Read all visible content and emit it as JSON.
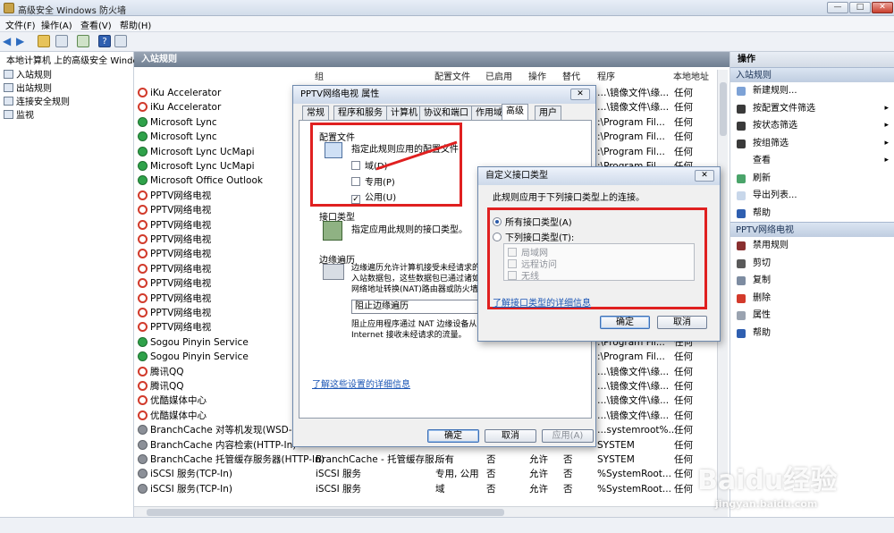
{
  "window": {
    "title": "高级安全 Windows 防火墙",
    "min": "—",
    "max": "□",
    "close": "✕"
  },
  "menu": [
    "文件(F)",
    "操作(A)",
    "查看(V)",
    "帮助(H)"
  ],
  "tree": {
    "root": "本地计算机 上的高级安全 Windo",
    "items": [
      "入站规则",
      "出站规则",
      "连接安全规则",
      "监视"
    ]
  },
  "center": {
    "title": "入站规则",
    "columns": [
      "组",
      "配置文件",
      "已启用",
      "操作",
      "替代",
      "程序",
      "本地地址"
    ],
    "rows": [
      {
        "name": "iKu Accelerator",
        "status": "block",
        "program": "…\\镜像文件\\缘...",
        "local": "任何"
      },
      {
        "name": "iKu Accelerator",
        "status": "block",
        "program": "…\\镜像文件\\缘...",
        "local": "任何"
      },
      {
        "name": "Microsoft Lync",
        "status": "ok",
        "program": ":\\Program Fil...",
        "local": "任何"
      },
      {
        "name": "Microsoft Lync",
        "status": "ok",
        "program": ":\\Program Fil...",
        "local": "任何"
      },
      {
        "name": "Microsoft Lync UcMapi",
        "status": "ok",
        "program": ":\\Program Fil...",
        "local": "任何"
      },
      {
        "name": "Microsoft Lync UcMapi",
        "status": "ok",
        "program": ":\\Program Fil...",
        "local": "任何"
      },
      {
        "name": "Microsoft Office Outlook",
        "status": "ok",
        "program": ":\\Program Fil...",
        "local": "任何"
      },
      {
        "name": "PPTV网络电视",
        "status": "block",
        "program": "",
        "local": ""
      },
      {
        "name": "PPTV网络电视",
        "status": "block",
        "program": "",
        "local": ""
      },
      {
        "name": "PPTV网络电视",
        "status": "block",
        "program": "",
        "local": ""
      },
      {
        "name": "PPTV网络电视",
        "status": "block",
        "program": "",
        "local": ""
      },
      {
        "name": "PPTV网络电视",
        "status": "block",
        "program": "",
        "local": ""
      },
      {
        "name": "PPTV网络电视",
        "status": "block",
        "program": "",
        "local": ""
      },
      {
        "name": "PPTV网络电视",
        "status": "block",
        "program": "",
        "local": ""
      },
      {
        "name": "PPTV网络电视",
        "status": "block",
        "program": "",
        "local": ""
      },
      {
        "name": "PPTV网络电视",
        "status": "block",
        "program": "",
        "local": ""
      },
      {
        "name": "PPTV网络电视",
        "status": "block",
        "program": "",
        "local": ""
      },
      {
        "name": "Sogou Pinyin Service",
        "status": "ok",
        "program": ":\\Program Fil...",
        "local": "任何"
      },
      {
        "name": "Sogou Pinyin Service",
        "status": "ok",
        "program": ":\\Program Fil...",
        "local": "任何"
      },
      {
        "name": "腾讯QQ",
        "status": "block",
        "program": "…\\镜像文件\\缘...",
        "local": "任何"
      },
      {
        "name": "腾讯QQ",
        "status": "block",
        "program": "…\\镜像文件\\缘...",
        "local": "任何"
      },
      {
        "name": "优酷媒体中心",
        "status": "block",
        "program": "…\\镜像文件\\缘...",
        "local": "任何"
      },
      {
        "name": "优酷媒体中心",
        "status": "block",
        "program": "…\\镜像文件\\缘...",
        "local": "任何"
      },
      {
        "name": "BranchCache 对等机发现(WSD-In)",
        "status": "gray",
        "program": "…systemroot%...",
        "local": "任何"
      },
      {
        "name": "BranchCache 内容检索(HTTP-In)",
        "status": "gray",
        "program": "SYSTEM",
        "local": "任何"
      },
      {
        "name": "BranchCache 托管缓存服务器(HTTP-In)",
        "status": "gray",
        "group": "BranchCache - 托管缓存服...",
        "profile": "所有",
        "enabled": "否",
        "action": "允许",
        "override": "否",
        "program": "SYSTEM",
        "local": "任何"
      },
      {
        "name": "iSCSI 服务(TCP-In)",
        "status": "gray",
        "group": "iSCSI 服务",
        "profile": "专用, 公用",
        "enabled": "否",
        "action": "允许",
        "override": "否",
        "program": "%SystemRoot...",
        "local": "任何"
      },
      {
        "name": "iSCSI 服务(TCP-In)",
        "status": "gray",
        "group": "iSCSI 服务",
        "profile": "域",
        "enabled": "否",
        "action": "允许",
        "override": "否",
        "program": "%SystemRoot...",
        "local": "任何"
      }
    ]
  },
  "actions": {
    "header": "操作",
    "section1": "入站规则",
    "items1": [
      "新建规则...",
      "按配置文件筛选",
      "按状态筛选",
      "按组筛选",
      "查看",
      "刷新",
      "导出列表...",
      "帮助"
    ],
    "section2": "PPTV网络电视",
    "items2": [
      "禁用规则",
      "剪切",
      "复制",
      "删除",
      "属性",
      "帮助"
    ],
    "arrow": "▸"
  },
  "props_dialog": {
    "title": "PPTV网络电视 属性",
    "close": "✕",
    "tabs": [
      "常规",
      "程序和服务",
      "计算机",
      "协议和端口",
      "作用域",
      "高级",
      "用户"
    ],
    "profile_title": "配置文件",
    "profile_desc": "指定此规则应用的配置文件",
    "profiles": [
      {
        "label": "域(D)",
        "checked": ""
      },
      {
        "label": "专用(P)",
        "checked": ""
      },
      {
        "label": "公用(U)",
        "checked": "✓"
      }
    ],
    "iface_title": "接口类型",
    "iface_desc": "指定应用此规则的接口类型。",
    "edge_title": "边缘遍历",
    "edge_desc": "边缘遍历允许计算机接受未经请求的入站数据包，这些数据包已通过诸如网络地址转换(NAT)路由器或防火墙之类的边缘设备(E)。",
    "edge_select": "阻止边缘遍历",
    "edge_note": "阻止应用程序通过 NAT 边缘设备从 Internet 接收未经请求的流量。",
    "link": "了解这些设置的详细信息",
    "ok": "确定",
    "cancel": "取消",
    "apply": "应用(A)"
  },
  "iface_dialog": {
    "title": "自定义接口类型",
    "close": "✕",
    "desc": "此规则应用于下列接口类型上的连接。",
    "opt_all": "所有接口类型(A)",
    "opt_these": "下列接口类型(T):",
    "types": [
      "局域网",
      "远程访问",
      "无线"
    ],
    "link": "了解接口类型的详细信息",
    "ok": "确定",
    "cancel": "取消"
  },
  "watermark": {
    "brand": "Baidu经验",
    "url": "jingyan.baidu.com"
  }
}
